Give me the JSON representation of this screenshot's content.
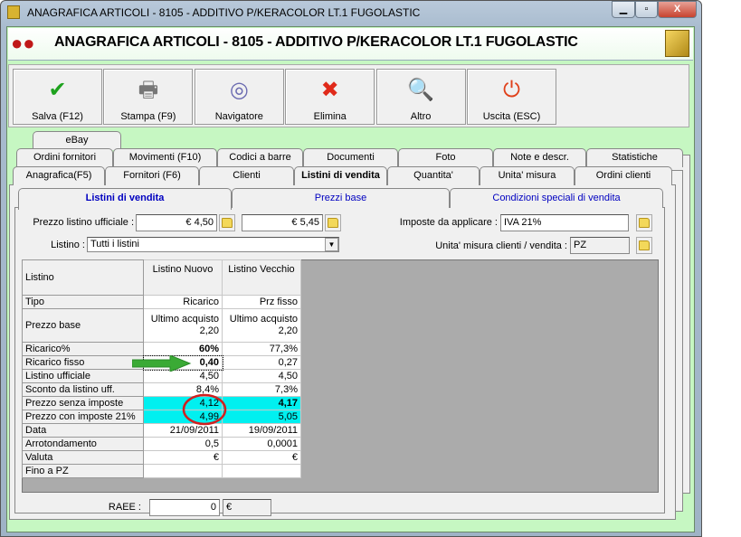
{
  "window": {
    "title": "ANAGRAFICA ARTICOLI - 8105 - ADDITIVO P/KERACOLOR LT.1 FUGOLASTIC",
    "minimize": "▁",
    "maximize": "▫",
    "close": "X"
  },
  "header": {
    "title": "ANAGRAFICA ARTICOLI - 8105 - ADDITIVO P/KERACOLOR LT.1 FUGOLASTIC"
  },
  "toolbar": [
    {
      "label": "Salva (F12)",
      "icon": "check-icon",
      "glyph": "✔",
      "color": "#1ea21e"
    },
    {
      "label": "Stampa (F9)",
      "icon": "printer-icon",
      "glyph": "🖶",
      "color": "#777777"
    },
    {
      "label": "Navigatore",
      "icon": "compass-icon",
      "glyph": "◎",
      "color": "#6a6ab0"
    },
    {
      "label": "Elimina",
      "icon": "x-icon",
      "glyph": "✖",
      "color": "#e02a1a"
    },
    {
      "label": "Altro",
      "icon": "book-search-icon",
      "glyph": "🔍",
      "color": "#1c5fc4"
    },
    {
      "label": "Uscita (ESC)",
      "icon": "power-icon",
      "glyph": "⏻",
      "color": "#e0401a"
    }
  ],
  "tabs": {
    "row1": [
      "eBay"
    ],
    "row2": [
      "Ordini fornitori",
      "Movimenti (F10)",
      "Codici a barre",
      "Documenti",
      "Foto",
      "Note e descr.",
      "Statistiche"
    ],
    "row3": [
      "Anagrafica(F5)",
      "Fornitori (F6)",
      "Clienti",
      "Listini di vendita",
      "Quantita'",
      "Unita' misura",
      "Ordini clienti"
    ]
  },
  "subtabs": [
    "Listini di vendita",
    "Prezzi base",
    "Condizioni speciali di vendita"
  ],
  "form": {
    "prezzo_label": "Prezzo listino ufficiale :",
    "prezzo1": "€ 4,50",
    "prezzo2": "€ 5,45",
    "imposte_label": "Imposte da applicare :",
    "imposte": "IVA 21%",
    "listino_label": "Listino :",
    "listino": "Tutti i listini",
    "unita_label": "Unita' misura clienti / vendita :",
    "unita": "PZ",
    "raee_label": "RAEE :",
    "raee": "0",
    "raee_cur": "€"
  },
  "table": {
    "headers": [
      "Listino",
      "Listino Nuovo",
      "Listino Vecchio"
    ],
    "rows": [
      [
        "Tipo",
        "Ricarico",
        "Prz fisso"
      ],
      [
        "Prezzo base",
        "Ultimo acquisto 2,20",
        "Ultimo acquisto 2,20"
      ],
      [
        "Ricarico%",
        "60%",
        "77,3%"
      ],
      [
        "Ricarico fisso",
        "0,40",
        "0,27"
      ],
      [
        "Listino ufficiale",
        "4,50",
        "4,50"
      ],
      [
        "Sconto da listino uff.",
        "8,4%",
        "7,3%"
      ],
      [
        "Prezzo senza imposte",
        "4,12",
        "4,17"
      ],
      [
        "Prezzo con imposte 21%",
        "4,99",
        "5,05"
      ],
      [
        "Data",
        "21/09/2011",
        "19/09/2011"
      ],
      [
        "Arrotondamento",
        "0,5",
        "0,0001"
      ],
      [
        "Valuta",
        "€",
        "€"
      ],
      [
        "Fino a PZ",
        "",
        ""
      ]
    ]
  }
}
